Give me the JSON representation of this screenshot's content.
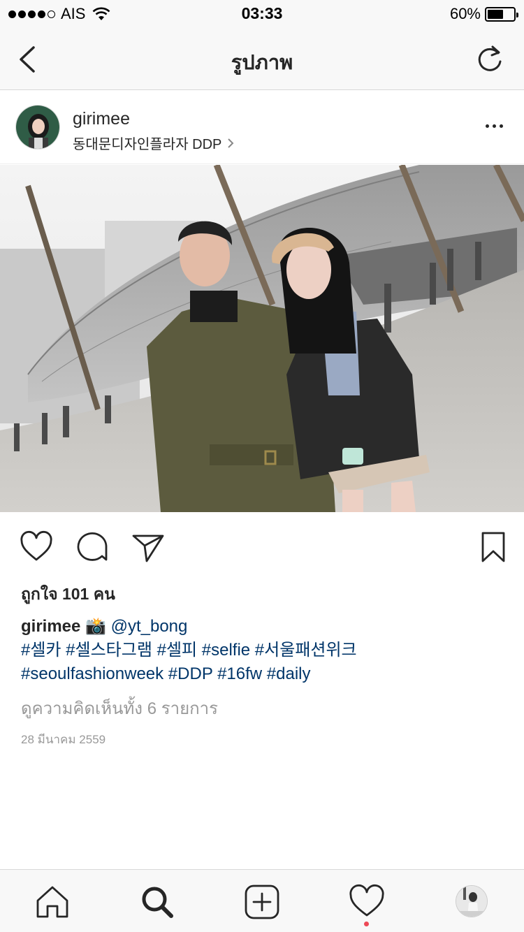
{
  "status_bar": {
    "carrier": "AIS",
    "time": "03:33",
    "battery_percent_label": "60%",
    "battery_level": 0.6
  },
  "nav": {
    "title": "รูปภาพ",
    "back_icon": "chevron-left-icon",
    "refresh_icon": "refresh-icon"
  },
  "post": {
    "username": "girimee",
    "location": "동대문디자인플라자 DDP",
    "photo_icon": "street-photo",
    "likes": "ถูกใจ 101 คน",
    "caption": {
      "username": "girimee",
      "camera_emoji": "📸",
      "mention": "@yt_bong",
      "tags_line1": "#셀카 #셀스타그램 #셀피 #selfie #서울패션위크",
      "tags_line2": "#seoulfashionweek #DDP #16fw #daily"
    },
    "view_comments": "ดูความคิดเห็นทั้ง 6 รายการ",
    "date": "28 มีนาคม 2559"
  },
  "tabbar": {
    "items": [
      "home-icon",
      "search-icon",
      "add-post-icon",
      "activity-icon",
      "profile-avatar"
    ]
  }
}
